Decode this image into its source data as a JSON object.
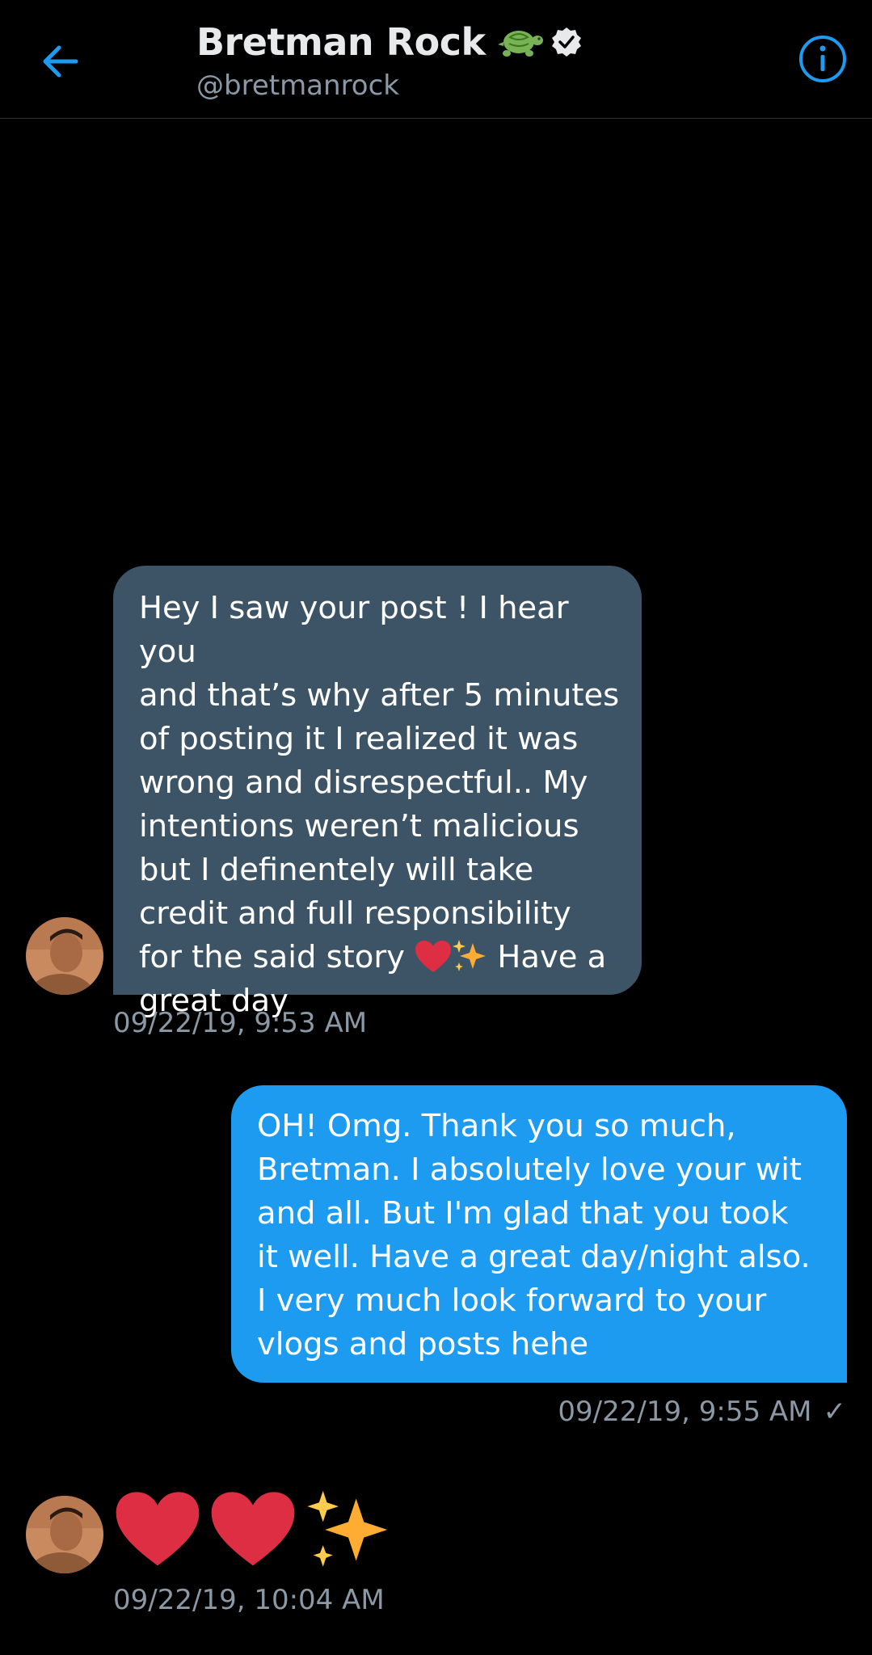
{
  "header": {
    "name": "Bretman Rock",
    "handle": "@bretmanrock",
    "name_emoji": "turtle-emoji",
    "verified": true
  },
  "icons": {
    "back": "arrow-left-icon",
    "info": "info-circle-icon",
    "check": "✓"
  },
  "messages": [
    {
      "direction": "incoming",
      "text_before_emoji": "Hey I saw your post ! I hear you\nand that’s why after 5 minutes\nof posting it I realized it was\nwrong and disrespectful.. My\nintentions weren’t malicious\nbut I definentely will take\ncredit and full responsibility\nfor the said story ",
      "emojis": [
        "heart",
        "sparkles"
      ],
      "text_after_emoji": " Have a\ngreat day",
      "timestamp": "09/22/19, 9:53 AM"
    },
    {
      "direction": "outgoing",
      "text": "OH! Omg. Thank you so much,\nBretman. I absolutely love your wit\nand all. But I'm glad that you took\nit well. Have a great day/night also.\nI very much look forward to your\nvlogs and posts hehe",
      "timestamp": "09/22/19, 9:55 AM",
      "read_check": true
    },
    {
      "direction": "incoming",
      "emoji_only": [
        "heart",
        "heart",
        "sparkles"
      ],
      "timestamp": "09/22/19, 10:04 AM"
    }
  ],
  "colors": {
    "background": "#000000",
    "accent": "#1d9bf0",
    "incoming_bubble": "#3d5466",
    "secondary_text": "#8b98a5",
    "heart": "#dd2e44",
    "sparkle": "#ffac33"
  }
}
